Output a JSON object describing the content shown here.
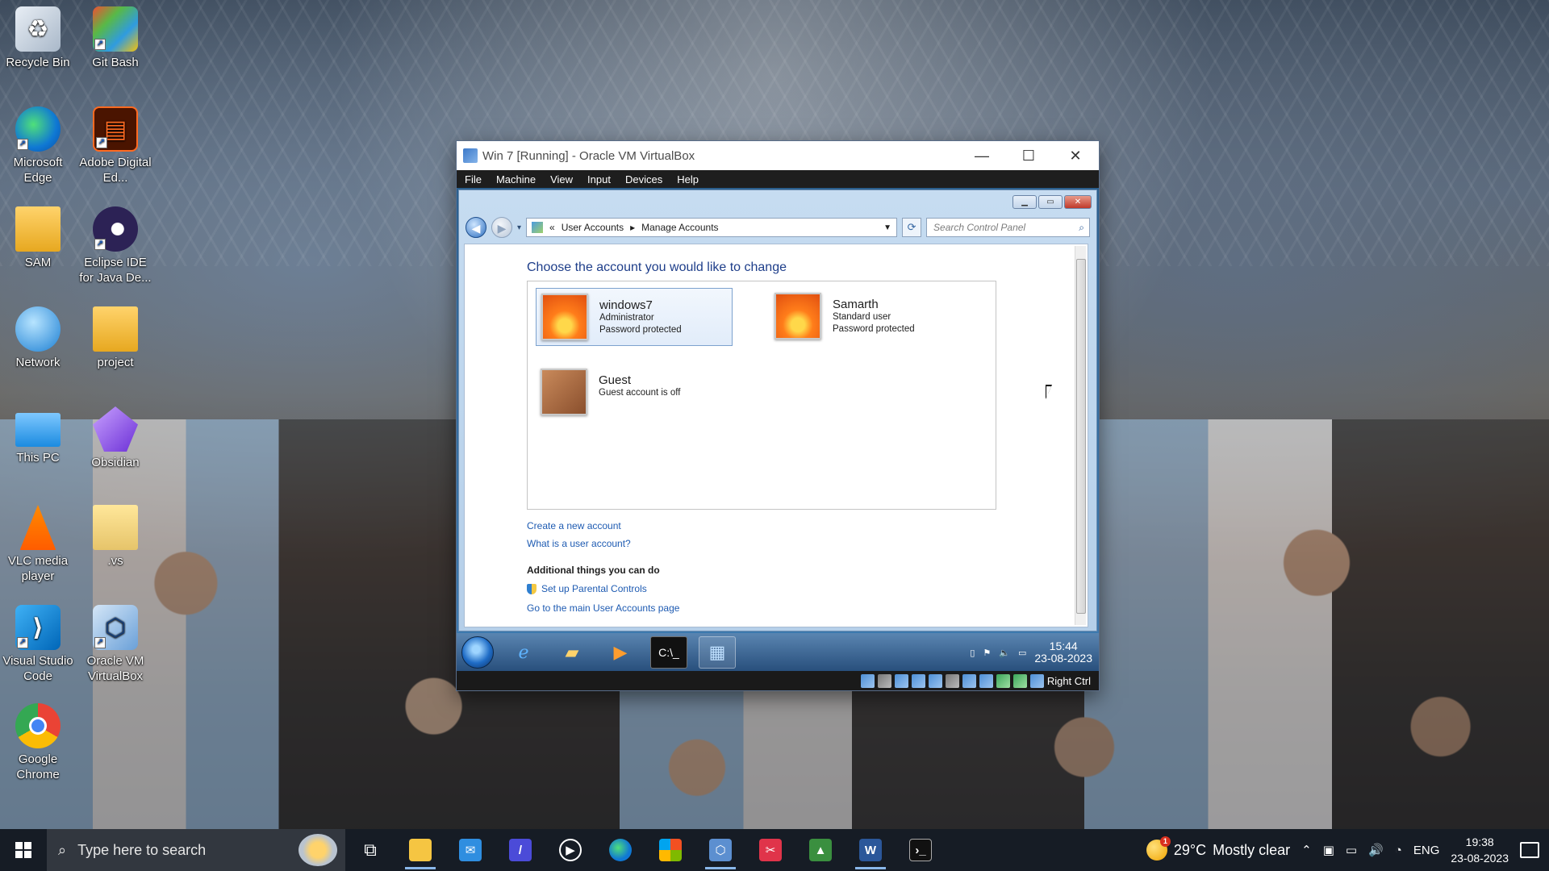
{
  "desktop": {
    "icons": [
      {
        "label": "Recycle Bin",
        "icon": "recycle-bin-icon"
      },
      {
        "label": "Git Bash",
        "icon": "git-bash-icon"
      },
      {
        "label": "Microsoft Edge",
        "icon": "edge-icon"
      },
      {
        "label": "Adobe Digital Ed...",
        "icon": "adobe-digital-editions-icon"
      },
      {
        "label": "SAM",
        "icon": "folder-icon"
      },
      {
        "label": "Eclipse IDE for Java De...",
        "icon": "eclipse-icon"
      },
      {
        "label": "Network",
        "icon": "network-icon"
      },
      {
        "label": "project",
        "icon": "folder-icon"
      },
      {
        "label": "This PC",
        "icon": "this-pc-icon"
      },
      {
        "label": "Obsidian",
        "icon": "obsidian-icon"
      },
      {
        "label": "VLC media player",
        "icon": "vlc-icon"
      },
      {
        "label": ".vs",
        "icon": "folder-icon"
      },
      {
        "label": "Visual Studio Code",
        "icon": "vscode-icon"
      },
      {
        "label": "Oracle VM VirtualBox",
        "icon": "virtualbox-icon"
      },
      {
        "label": "Google Chrome",
        "icon": "chrome-icon"
      }
    ]
  },
  "vbox": {
    "title": "Win 7 [Running] - Oracle VM VirtualBox",
    "menu": [
      "File",
      "Machine",
      "View",
      "Input",
      "Devices",
      "Help"
    ],
    "controls": {
      "minimize": "—",
      "maximize": "☐",
      "close": "✕"
    },
    "status_key": "Right Ctrl"
  },
  "win7": {
    "nav": {
      "back": "◀",
      "forward": "▶",
      "dropdown": "▾"
    },
    "breadcrumb": {
      "sep1": "«",
      "item1": "User Accounts",
      "sep2": "▸",
      "item2": "Manage Accounts"
    },
    "search_placeholder": "Search Control Panel",
    "heading": "Choose the account you would like to change",
    "accounts": [
      {
        "name": "windows7",
        "line1": "Administrator",
        "line2": "Password protected"
      },
      {
        "name": "Samarth",
        "line1": "Standard user",
        "line2": "Password protected"
      },
      {
        "name": "Guest",
        "line1": "Guest account is off",
        "line2": ""
      }
    ],
    "links": {
      "create": "Create a new account",
      "what_is": "What is a user account?",
      "additional_heading": "Additional things you can do",
      "parental": "Set up Parental Controls",
      "main_page": "Go to the main User Accounts page"
    },
    "taskbar": {
      "time": "15:44",
      "date": "23-08-2023"
    }
  },
  "taskbar": {
    "search_placeholder": "Type here to search",
    "weather_temp": "29°C",
    "weather_text": "Mostly clear",
    "weather_badge": "1",
    "language": "ENG",
    "time": "19:38",
    "date": "23-08-2023"
  },
  "colors": {
    "link": "#1e5bb2",
    "heading": "#1e3e8a",
    "host_taskbar": "#161c26",
    "w7_taskbar": "#274e7b"
  }
}
